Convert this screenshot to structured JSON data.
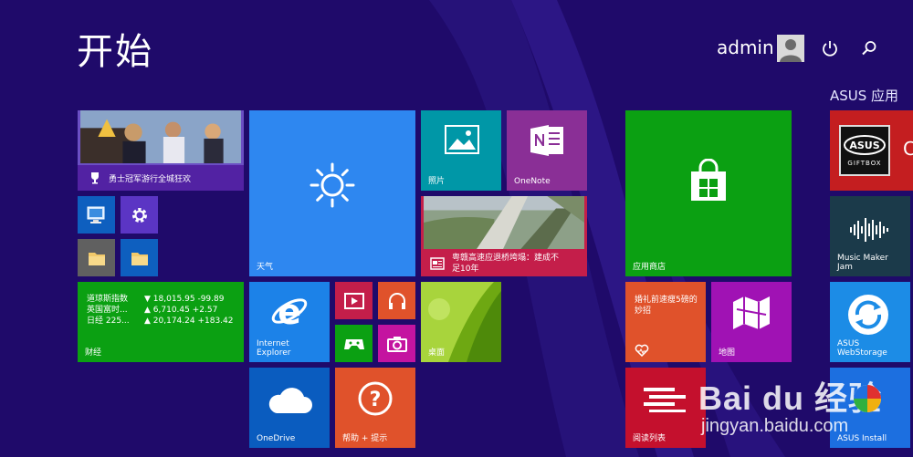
{
  "header": {
    "title": "开始",
    "user_name": "admin"
  },
  "groups": {
    "asus_label": "ASUS 应用"
  },
  "tiles": {
    "sports": {
      "label": "勇士冠军游行全城狂欢"
    },
    "weather": {
      "label": "天气"
    },
    "photos": {
      "label": "照片"
    },
    "onenote": {
      "label": "OneNote"
    },
    "news": {
      "label_line1": "粤赣高速应退桥垮塌：建成不",
      "label_line2": "足10年"
    },
    "finance": {
      "label": "财经",
      "rows": [
        {
          "name": "道琼斯指数",
          "arrow": "▼",
          "value": "18,015.95 -99.89"
        },
        {
          "name": "英国富时...",
          "arrow": "▲",
          "value": "6,710.45 +2.57"
        },
        {
          "name": "日经 225...",
          "arrow": "▲",
          "value": "20,174.24 +183.42"
        }
      ]
    },
    "ie": {
      "label_line1": "Internet",
      "label_line2": "Explorer"
    },
    "desktop": {
      "label": "桌面"
    },
    "onedrive": {
      "label": "OneDrive"
    },
    "help": {
      "label": "帮助 + 提示"
    },
    "store": {
      "label": "应用商店"
    },
    "health": {
      "label_line1": "婚礼前速瘦5磅的",
      "label_line2": "妙招"
    },
    "maps": {
      "label": "地图"
    },
    "reading": {
      "label": "阅读列表"
    },
    "asus_giftbox": {
      "label": "GIFTBOX"
    },
    "music_maker": {
      "label_line1": "Music Maker",
      "label_line2": "Jam"
    },
    "webstorage": {
      "label_line1": "ASUS",
      "label_line2": "WebStorage"
    },
    "asus_install": {
      "label": "ASUS Install"
    }
  },
  "watermark": {
    "brand": "Bai du 经验",
    "url": "jingyan.baidu.com"
  },
  "colors": {
    "background": "#1f0a6a",
    "weather": "#2e87f0",
    "store": "#0ba012",
    "finance": "#0ba012",
    "onenote": "#8a2f96",
    "photos": "#0097a7",
    "news_bar": "#c41e4a",
    "help": "#e0522b",
    "maps": "#a012b4",
    "health": "#e0522b",
    "reading": "#c4102d"
  },
  "icons": {
    "power": "power-icon",
    "search": "search-icon",
    "weather": "sun-icon",
    "store": "shopping-bag-icon",
    "onedrive": "cloud-icon",
    "help": "question-icon",
    "ie": "ie-logo-icon"
  }
}
